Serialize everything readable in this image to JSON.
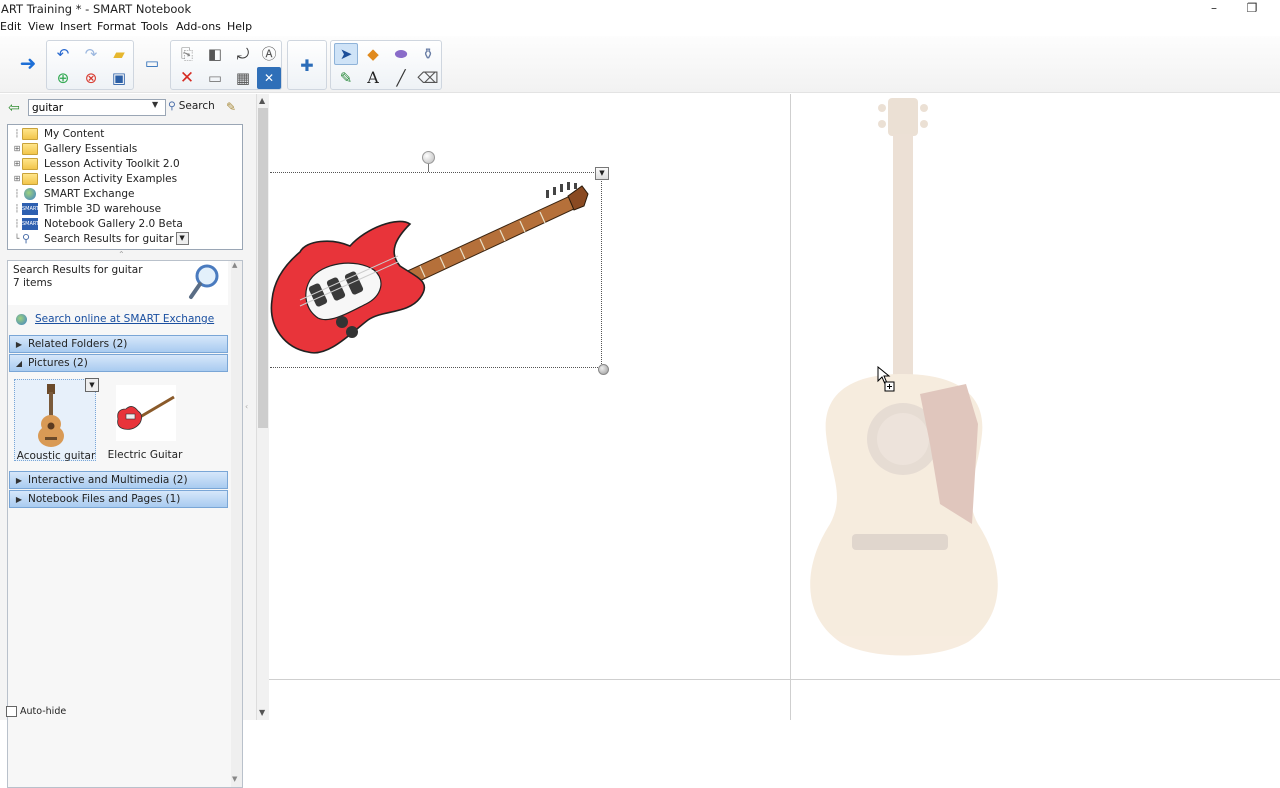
{
  "window": {
    "title": "ART Training * - SMART Notebook",
    "minimize_glyph": "–",
    "restore_glyph": "❐"
  },
  "menubar": [
    "Edit",
    "View",
    "Insert",
    "Format",
    "Tools",
    "Add-ons",
    "Help"
  ],
  "toolbar": {
    "icons": [
      "next-page-icon",
      "undo-icon",
      "redo-icon",
      "open-icon",
      "add-page-icon",
      "delete-page-icon",
      "save-icon",
      "screen-shade-icon",
      "delete-icon",
      "paste-icon",
      "screen-capture-icon",
      "fit-icon",
      "table-icon",
      "close-icon",
      "add-ons-icon",
      "select-icon",
      "shapes-icon",
      "eraser-icon",
      "pen-icon",
      "text-icon",
      "line-icon",
      "magic-pen-icon"
    ]
  },
  "gallery": {
    "search_value": "guitar",
    "search_button": "Search",
    "tree": [
      {
        "label": "My Content",
        "icon": "folder-icon"
      },
      {
        "label": "Gallery Essentials",
        "icon": "folder-icon"
      },
      {
        "label": "Lesson Activity Toolkit 2.0",
        "icon": "folder-icon"
      },
      {
        "label": "Lesson Activity Examples",
        "icon": "folder-icon"
      },
      {
        "label": "SMART Exchange",
        "icon": "globe-icon"
      },
      {
        "label": "Trimble 3D warehouse",
        "icon": "smart-icon"
      },
      {
        "label": "Notebook Gallery 2.0 Beta",
        "icon": "smart-icon"
      },
      {
        "label": "Search Results for guitar",
        "icon": "magnifier-icon"
      }
    ],
    "results_title": "Search Results for guitar",
    "results_count": "7 items",
    "search_online": "Search online at SMART Exchange",
    "categories": {
      "related": "Related Folders (2)",
      "pictures": "Pictures (2)",
      "interactive": "Interactive and Multimedia (2)",
      "notebook": "Notebook Files and Pages (1)"
    },
    "thumbnails": [
      {
        "caption": "Acoustic guitar"
      },
      {
        "caption": "Electric Guitar"
      }
    ],
    "autohide": "Auto-hide"
  },
  "colors": {
    "accent": "#7aa6d6",
    "guitar_body": "#e8343a",
    "acoustic_body": "#e8c9a3"
  }
}
